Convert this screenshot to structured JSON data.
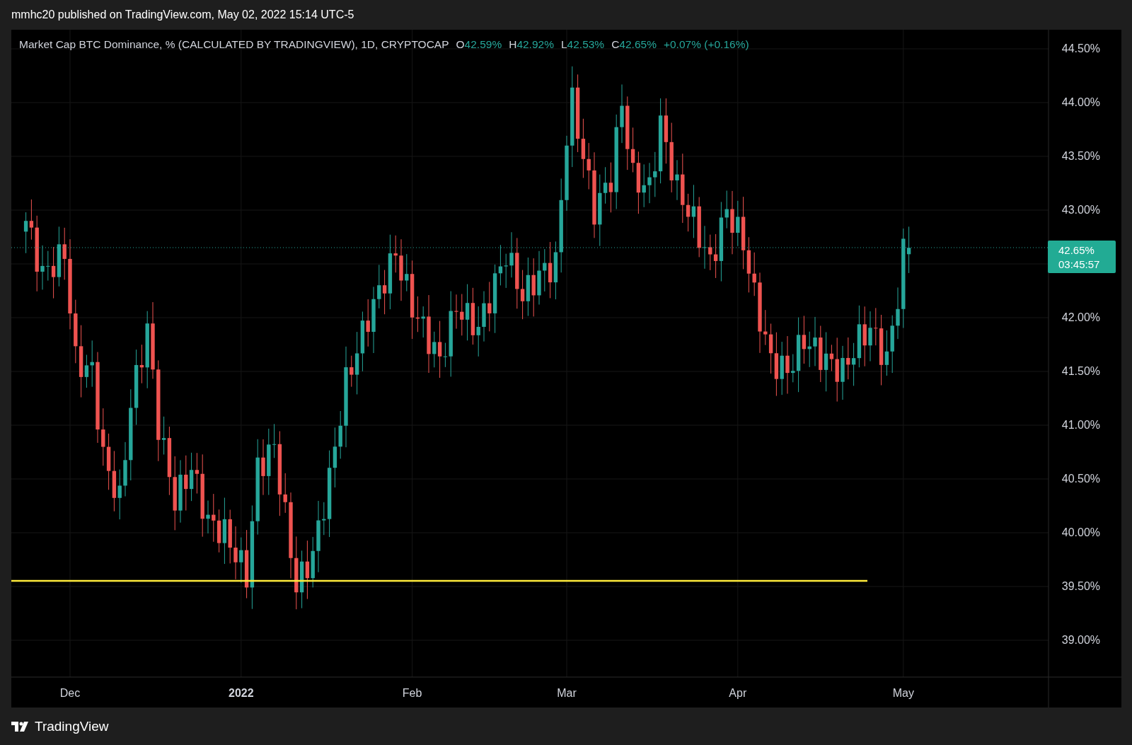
{
  "header": {
    "publisher": "mmhc20 published on TradingView.com, May 02, 2022 15:14 UTC-5"
  },
  "legend": {
    "title": "Market Cap BTC Dominance, % (CALCULATED BY TRADINGVIEW), 1D, CRYPTOCAP",
    "values": [
      {
        "key": "O",
        "value": "42.59%"
      },
      {
        "key": "H",
        "value": "42.92%"
      },
      {
        "key": "L",
        "value": "42.53%"
      },
      {
        "key": "C",
        "value": "42.65%"
      }
    ],
    "change": "+0.07% (+0.16%)"
  },
  "price_axis": {
    "ticks": [
      "44.50%",
      "44.00%",
      "43.50%",
      "43.00%",
      "42.00%",
      "41.50%",
      "41.00%",
      "40.50%",
      "40.00%",
      "39.50%",
      "39.00%"
    ]
  },
  "time_axis": {
    "labels": [
      {
        "text": "Dec",
        "kind": "month"
      },
      {
        "text": "2022",
        "kind": "year"
      },
      {
        "text": "Feb",
        "kind": "month"
      },
      {
        "text": "Mar",
        "kind": "month"
      },
      {
        "text": "Apr",
        "kind": "month"
      },
      {
        "text": "May",
        "kind": "month"
      }
    ]
  },
  "last_price": {
    "price": "42.65%",
    "countdown": "03:45:57"
  },
  "footer": {
    "brand": "TradingView"
  }
}
